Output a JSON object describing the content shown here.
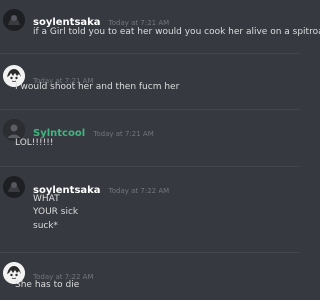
{
  "messages": [
    {
      "username": "soylentsaka",
      "timestamp": "Today at 7:21 AM",
      "lines": [
        "if a Girl told you to eat her would you cook her alive on a spitroast"
      ]
    },
    {
      "username": "",
      "timestamp": "Today at 7:21 AM",
      "lines": [
        "I would shoot her and then fucm her"
      ]
    },
    {
      "username": "Sylntcool",
      "timestamp": "Today at 7:21 AM",
      "lines": [
        "LOL!!!!!!"
      ]
    },
    {
      "username": "soylentsaka",
      "timestamp": "Today at 7:22 AM",
      "lines": [
        "WHAT",
        "YOUR sick",
        "suck*"
      ]
    },
    {
      "username": "",
      "timestamp": "Today at 7:22 AM",
      "lines": [
        "She has to die"
      ]
    }
  ],
  "colors": {
    "background": "#36393f",
    "username_default": "#ffffff",
    "username_green": "#43b581",
    "timestamp": "#72767d",
    "message_text": "#dcddde"
  }
}
